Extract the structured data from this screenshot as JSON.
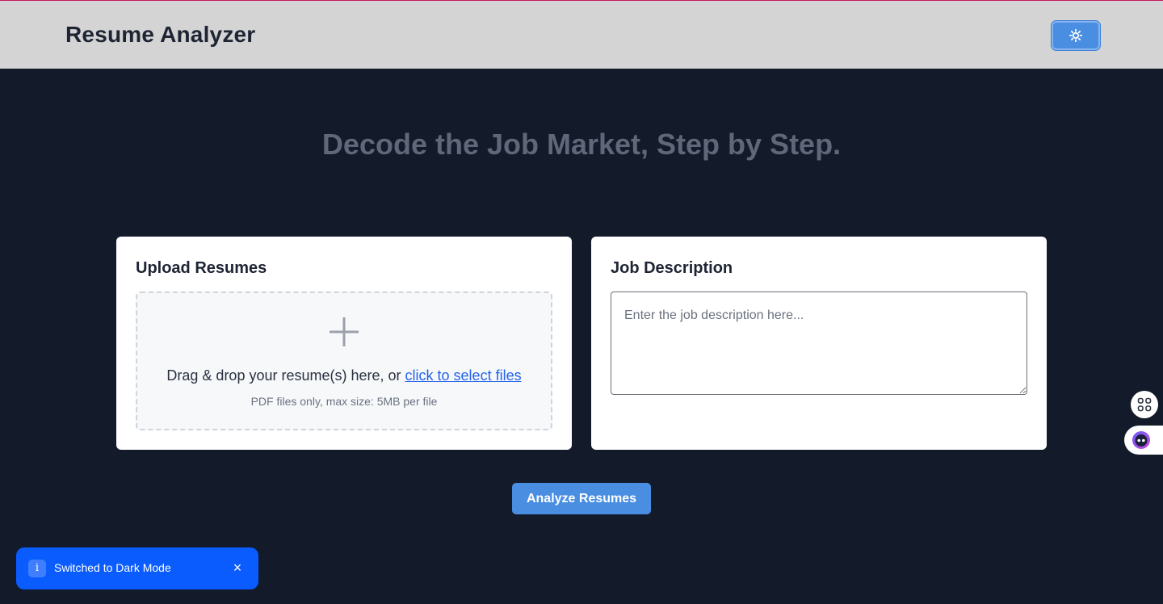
{
  "header": {
    "app_title": "Resume Analyzer",
    "theme_toggle_icon": "sun-icon"
  },
  "hero": {
    "heading": "Decode the Job Market, Step by Step."
  },
  "upload_card": {
    "title": "Upload Resumes",
    "drop_text": "Drag & drop your resume(s) here, or ",
    "select_link": "click to select files",
    "hint": "PDF files only, max size: 5MB per file",
    "icon": "plus-icon"
  },
  "job_card": {
    "title": "Job Description",
    "placeholder": "Enter the job description here...",
    "value": ""
  },
  "actions": {
    "analyze_label": "Analyze Resumes"
  },
  "toast": {
    "icon": "info-icon",
    "icon_glyph": "i",
    "message": "Switched to Dark Mode",
    "close_glyph": "×"
  },
  "floating": {
    "apps_icon": "grid-apps-icon",
    "assistant_icon": "assistant-bot-icon"
  },
  "colors": {
    "page_bg": "#131a2a",
    "header_bg": "#d4d4d4",
    "accent": "#4a8ee2",
    "toast_bg": "#0a5cff",
    "link": "#2563eb"
  }
}
